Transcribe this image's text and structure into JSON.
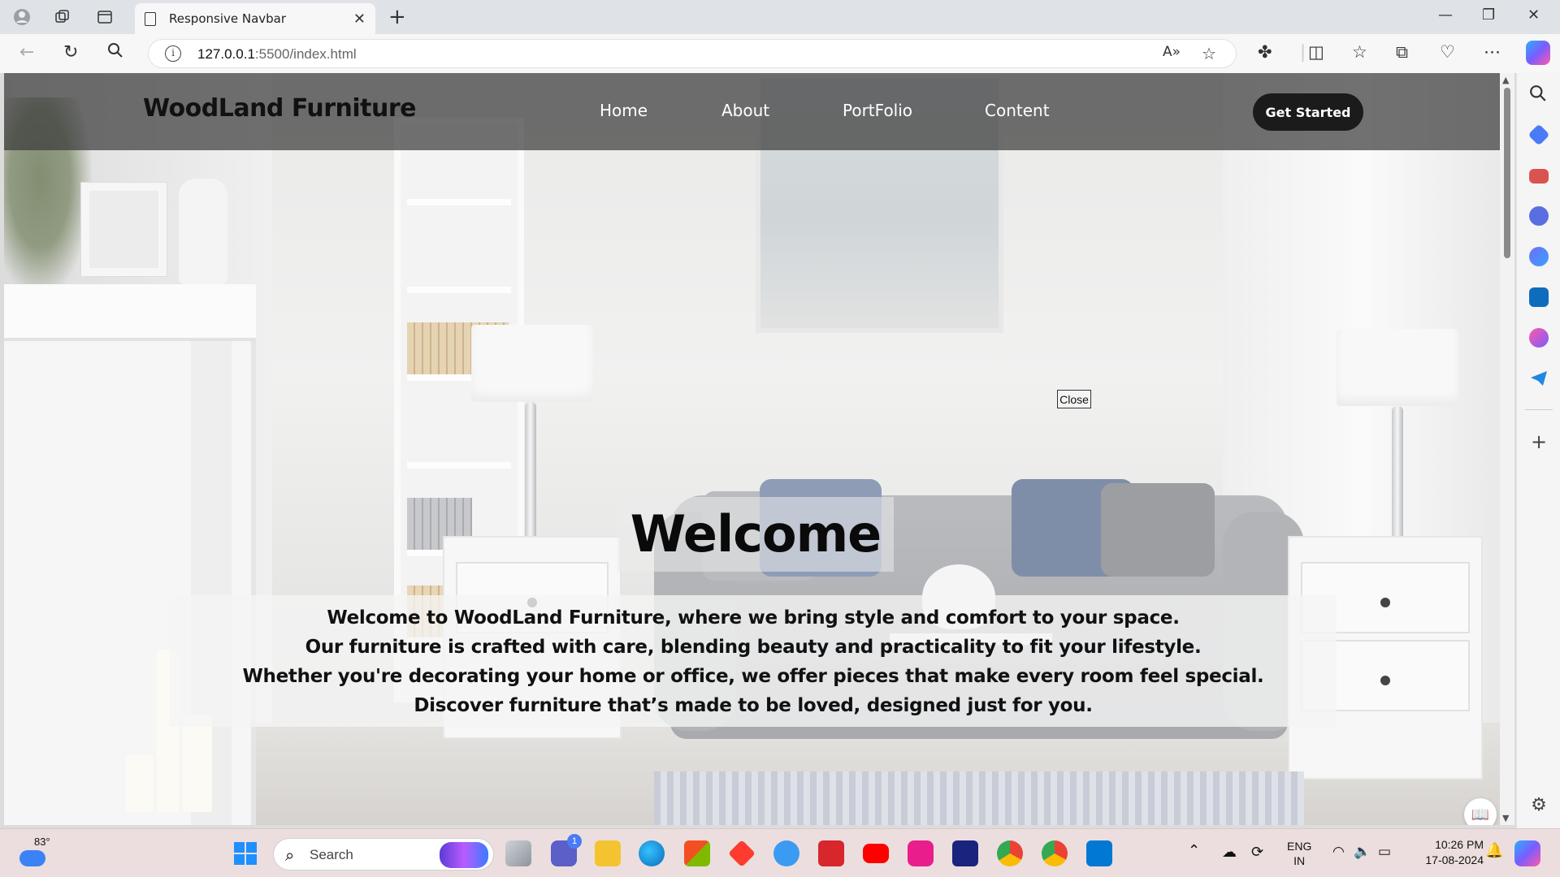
{
  "browser": {
    "tab_title": "Responsive Navbar",
    "url_host": "127.0.0.1",
    "url_path": ":5500/index.html"
  },
  "site": {
    "brand": "WoodLand Furniture",
    "nav": [
      "Home",
      "About",
      "PortFolio",
      "Content"
    ],
    "cta": "Get Started",
    "close_label": "Close",
    "hero_title": "Welcome",
    "hero_lines": [
      "Welcome to WoodLand Furniture, where we bring style and comfort to your space.",
      "Our furniture is crafted with care, blending beauty and practicality to fit your lifestyle.",
      "Whether you're decorating your home or office, we offer pieces that make every room feel special.",
      "Discover furniture that’s made to be loved, designed just for you."
    ]
  },
  "taskbar": {
    "weather_temp": "83°",
    "search_label": "Search",
    "lang_line1": "ENG",
    "lang_line2": "IN",
    "time": "10:26 PM",
    "date": "17-08-2024",
    "teams_badge": "1"
  },
  "colors": {
    "nav_overlay": "#3c3c3c",
    "cta_bg": "#1b1b1b",
    "taskbar_bg": "#ecdede"
  }
}
